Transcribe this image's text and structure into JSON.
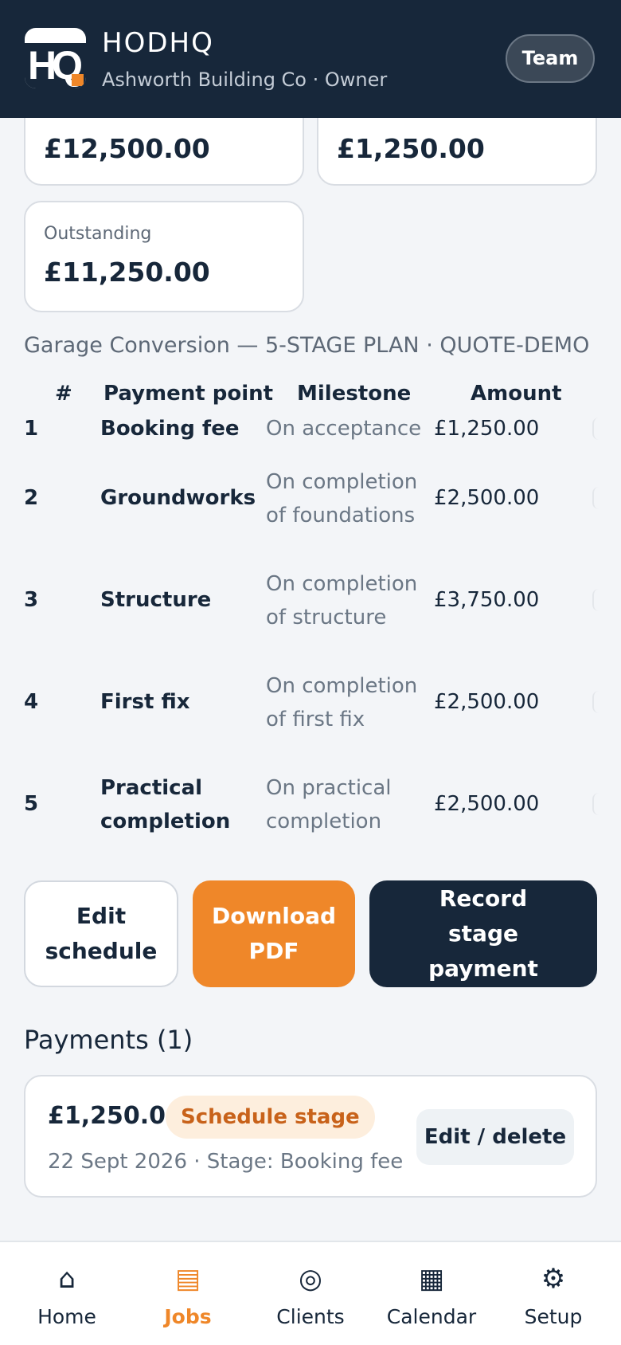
{
  "header": {
    "logo_text": "HQ",
    "brand": "HODHQ",
    "subtitle": "Ashworth Building Co · Owner",
    "team_button": "Team"
  },
  "summary": {
    "card_a_value": "£12,500.00",
    "card_b_value": "£1,250.00",
    "outstanding_label": "Outstanding",
    "outstanding_value": "£11,250.00"
  },
  "plan": {
    "title": "Garage Conversion — 5-STAGE PLAN · QUOTE-DEMO"
  },
  "schedule": {
    "headers": {
      "num": "#",
      "point": "Payment point",
      "milestone": "Milestone",
      "amount": "Amount"
    },
    "rows": [
      {
        "num": "1",
        "point": "Booking fee",
        "milestone": "On acceptance",
        "amount": "£1,250.00"
      },
      {
        "num": "2",
        "point": "Groundworks",
        "milestone": "On completion of foundations",
        "amount": "£2,500.00"
      },
      {
        "num": "3",
        "point": "Structure",
        "milestone": "On completion of structure",
        "amount": "£3,750.00"
      },
      {
        "num": "4",
        "point": "First fix",
        "milestone": "On completion of first fix",
        "amount": "£2,500.00"
      },
      {
        "num": "5",
        "point": "Practical completion",
        "milestone": "On practical completion",
        "amount": "£2,500.00"
      }
    ]
  },
  "actions": {
    "edit": "Edit schedule",
    "pdf": "Download PDF",
    "record": "Record stage payment"
  },
  "payments": {
    "title": "Payments (1)",
    "items": [
      {
        "amount": "£1,250.00",
        "badge": "Schedule stage",
        "detail": "22 Sept 2026 · Stage: Booking fee",
        "edit": "Edit / delete"
      }
    ]
  },
  "nav": [
    {
      "icon": "⌂",
      "icon_name": "home-icon",
      "label": "Home",
      "active": false
    },
    {
      "icon": "▤",
      "icon_name": "jobs-icon",
      "label": "Jobs",
      "active": true
    },
    {
      "icon": "◎",
      "icon_name": "clients-icon",
      "label": "Clients",
      "active": false
    },
    {
      "icon": "▦",
      "icon_name": "calendar-icon",
      "label": "Calendar",
      "active": false
    },
    {
      "icon": "⚙",
      "icon_name": "setup-icon",
      "label": "Setup",
      "active": false
    }
  ],
  "colors": {
    "navy": "#17273a",
    "accent": "#ef8729",
    "badge_bg": "#fdeedd",
    "badge_text": "#c8621a"
  }
}
